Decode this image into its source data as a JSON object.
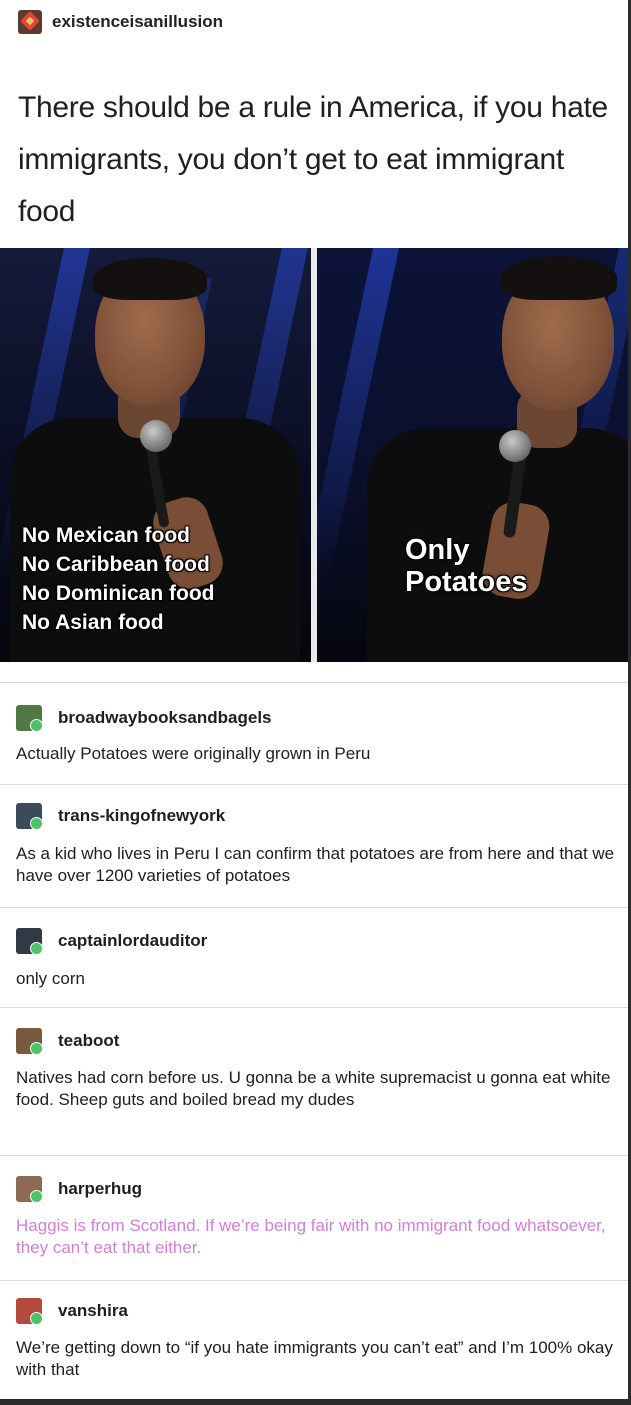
{
  "op": {
    "username": "existenceisanillusion",
    "text": "There should be a rule in America, if you hate immigrants, you don’t get to eat immigrant food",
    "avatar_icon": "red-gem-avatar-icon"
  },
  "meme": {
    "left_caption": [
      "No Mexican food",
      "No Caribbean food",
      "No Dominican food",
      "No Asian food"
    ],
    "right_caption": [
      "Only",
      "Potatoes"
    ]
  },
  "replies": [
    {
      "username": "broadwaybooksandbagels",
      "text": "Actually Potatoes were originally grown in Peru",
      "avatar_color": "#4f7a46",
      "text_color": "#1e1e1e"
    },
    {
      "username": "trans-kingofnewyork",
      "text": "As a kid who lives in Peru I can confirm that potatoes are from here and that we have over 1200 varieties of potatoes",
      "avatar_color": "#3d4a5c",
      "text_color": "#1e1e1e"
    },
    {
      "username": "captainlordauditor",
      "text": "only corn",
      "avatar_color": "#2f3a45",
      "text_color": "#1e1e1e"
    },
    {
      "username": "teaboot",
      "text": "Natives had corn before us. U gonna be a white supremacist u gonna eat white food. Sheep guts and boiled bread my dudes",
      "avatar_color": "#7a5a3f",
      "text_color": "#1e1e1e"
    },
    {
      "username": "harperhug",
      "text": "Haggis is from Scotland. If we’re being fair with no immigrant food whatsoever, they can’t eat that either.",
      "avatar_color": "#8c6a55",
      "text_color": "#d27fd6"
    },
    {
      "username": "vanshira",
      "text": "We’re getting down to “if you hate immigrants you can’t eat” and I’m 100% okay with that",
      "avatar_color": "#b44a3c",
      "text_color": "#1e1e1e"
    }
  ]
}
